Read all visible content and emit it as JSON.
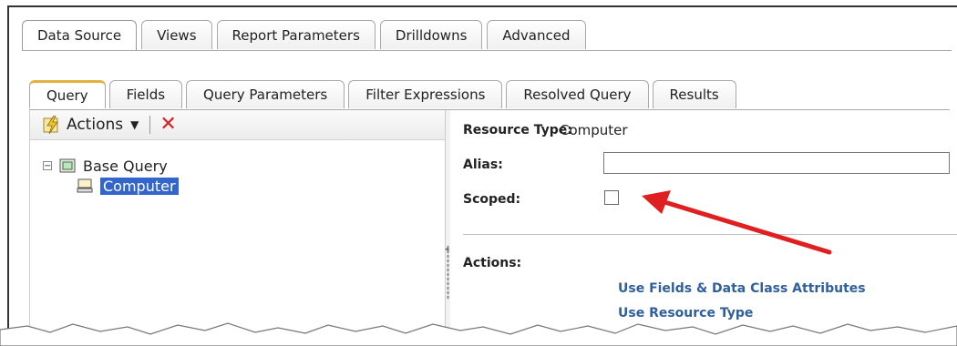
{
  "top_tabs": [
    "Data Source",
    "Views",
    "Report Parameters",
    "Drilldowns",
    "Advanced"
  ],
  "inner_tabs": [
    "Query",
    "Fields",
    "Query Parameters",
    "Filter Expressions",
    "Resolved Query",
    "Results"
  ],
  "toolbar": {
    "actions_label": "Actions",
    "actions_icon": "actions-lightning-icon",
    "delete_icon": "delete-x-icon"
  },
  "tree": {
    "root_label": "Base Query",
    "child_label": "Computer"
  },
  "details": {
    "resource_type_label": "Resource Type:",
    "resource_type_value": "Computer",
    "alias_label": "Alias:",
    "alias_value": "",
    "scoped_label": "Scoped:",
    "scoped_checked": false,
    "actions_label": "Actions:",
    "action_links": [
      "Use Fields & Data Class Attributes",
      "Use Resource Type"
    ]
  },
  "colors": {
    "accent_tab": "#e2b23c",
    "link": "#2e5f9e",
    "selection": "#3366cc",
    "arrow": "#e02020",
    "delete": "#d42020"
  }
}
